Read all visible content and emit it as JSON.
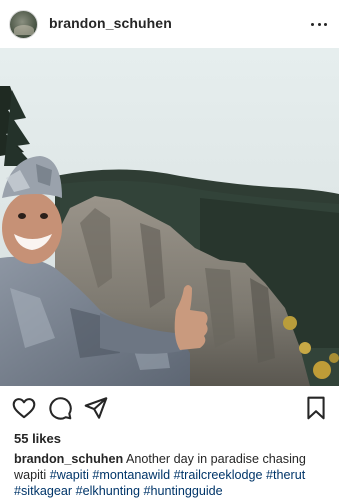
{
  "post": {
    "username": "brandon_schuhen",
    "likes": "55 likes",
    "caption": {
      "username": "brandon_schuhen",
      "text": " Another day in paradise chasing wapiti  ",
      "hashtags": [
        "#wapiti",
        "#montanawild",
        "#trailcreeklodge",
        "#therut",
        "#sitkagear",
        "#elkhunting",
        "#huntingguide"
      ]
    }
  },
  "icons": {
    "more": "more-horizontal-icon",
    "like": "heart-icon",
    "comment": "comment-bubble-icon",
    "share": "paper-plane-icon",
    "save": "bookmark-icon"
  },
  "colors": {
    "text": "#262626",
    "hashtag": "#003569",
    "divider": "#efefef"
  }
}
